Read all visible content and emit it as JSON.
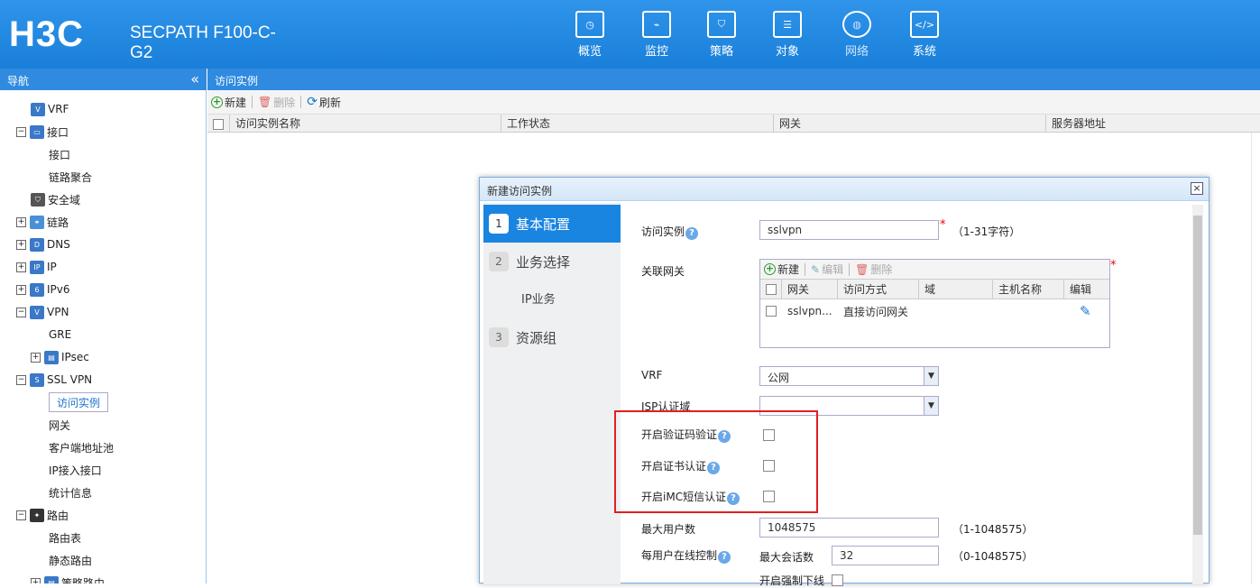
{
  "header": {
    "logo": "H3C",
    "product": "SECPATH F100-C-G2"
  },
  "nav": [
    {
      "label": "概览",
      "icon": "gauge-icon"
    },
    {
      "label": "监控",
      "icon": "monitor-icon"
    },
    {
      "label": "策略",
      "icon": "shield-icon"
    },
    {
      "label": "对象",
      "icon": "server-icon"
    },
    {
      "label": "网络",
      "icon": "internet-icon"
    },
    {
      "label": "系统",
      "icon": "code-icon"
    }
  ],
  "sidebar": {
    "title": "导航",
    "collapse": "«",
    "items": [
      {
        "label": "VRF",
        "icon": "vrf-icon"
      },
      {
        "label": "接口",
        "icon": "interface-icon",
        "toggle": "−"
      },
      {
        "label": "接口"
      },
      {
        "label": "链路聚合"
      },
      {
        "label": "安全域",
        "icon": "security-zone-icon"
      },
      {
        "label": "链路",
        "icon": "link-icon",
        "toggle": "+"
      },
      {
        "label": "DNS",
        "icon": "dns-icon",
        "toggle": "+"
      },
      {
        "label": "IP",
        "icon": "ip-icon",
        "toggle": "+"
      },
      {
        "label": "IPv6",
        "icon": "ipv6-icon",
        "toggle": "+"
      },
      {
        "label": "VPN",
        "icon": "vpn-icon",
        "toggle": "−"
      },
      {
        "label": "GRE"
      },
      {
        "label": "IPsec",
        "icon": "ipsec-icon",
        "toggle": "+"
      },
      {
        "label": "SSL VPN",
        "icon": "sslvpn-icon",
        "toggle": "−"
      },
      {
        "label": "访问实例",
        "selected": true
      },
      {
        "label": "网关"
      },
      {
        "label": "客户端地址池"
      },
      {
        "label": "IP接入接口"
      },
      {
        "label": "统计信息"
      },
      {
        "label": "路由",
        "icon": "route-icon",
        "toggle": "−"
      },
      {
        "label": "路由表"
      },
      {
        "label": "静态路由"
      },
      {
        "label": "策略路由",
        "icon": "policy-route-icon",
        "toggle": "+"
      }
    ]
  },
  "content": {
    "title": "访问实例",
    "toolbar": {
      "new": "新建",
      "delete": "删除",
      "refresh": "刷新"
    },
    "columns": [
      "访问实例名称",
      "工作状态",
      "网关",
      "服务器地址"
    ]
  },
  "dialog": {
    "title": "新建访问实例",
    "close": "×",
    "steps": [
      {
        "num": "1",
        "label": "基本配置"
      },
      {
        "num": "2",
        "label": "业务选择"
      },
      {
        "num": "3",
        "label": "资源组"
      }
    ],
    "substep": "IP业务",
    "form": {
      "instance_label": "访问实例",
      "instance_value": "sslvpn",
      "instance_hint": "（1-31字符）",
      "gateway_label": "关联网关",
      "gw_toolbar": {
        "new": "新建",
        "edit": "编辑",
        "delete": "删除"
      },
      "gw_columns": [
        "网关",
        "访问方式",
        "域",
        "主机名称",
        "编辑"
      ],
      "gw_row": {
        "gateway": "sslvpn...",
        "mode": "直接访问网关",
        "domain": "",
        "host": ""
      },
      "vrf_label": "VRF",
      "vrf_value": "公网",
      "isp_label": "ISP认证域",
      "isp_value": "",
      "captcha_label": "开启验证码验证",
      "cert_label": "开启证书认证",
      "imc_label": "开启iMC短信认证",
      "max_users_label": "最大用户数",
      "max_users_value": "1048575",
      "max_users_hint": "（1-1048575）",
      "per_user_label": "每用户在线控制",
      "max_sessions_label": "最大会话数",
      "max_sessions_value": "32",
      "max_sessions_hint": "（0-1048575）",
      "force_offline_label": "开启强制下线"
    }
  },
  "colors": {
    "header": "#1a7fd9",
    "accent": "#1a85e0",
    "highlight": "#e02020"
  }
}
